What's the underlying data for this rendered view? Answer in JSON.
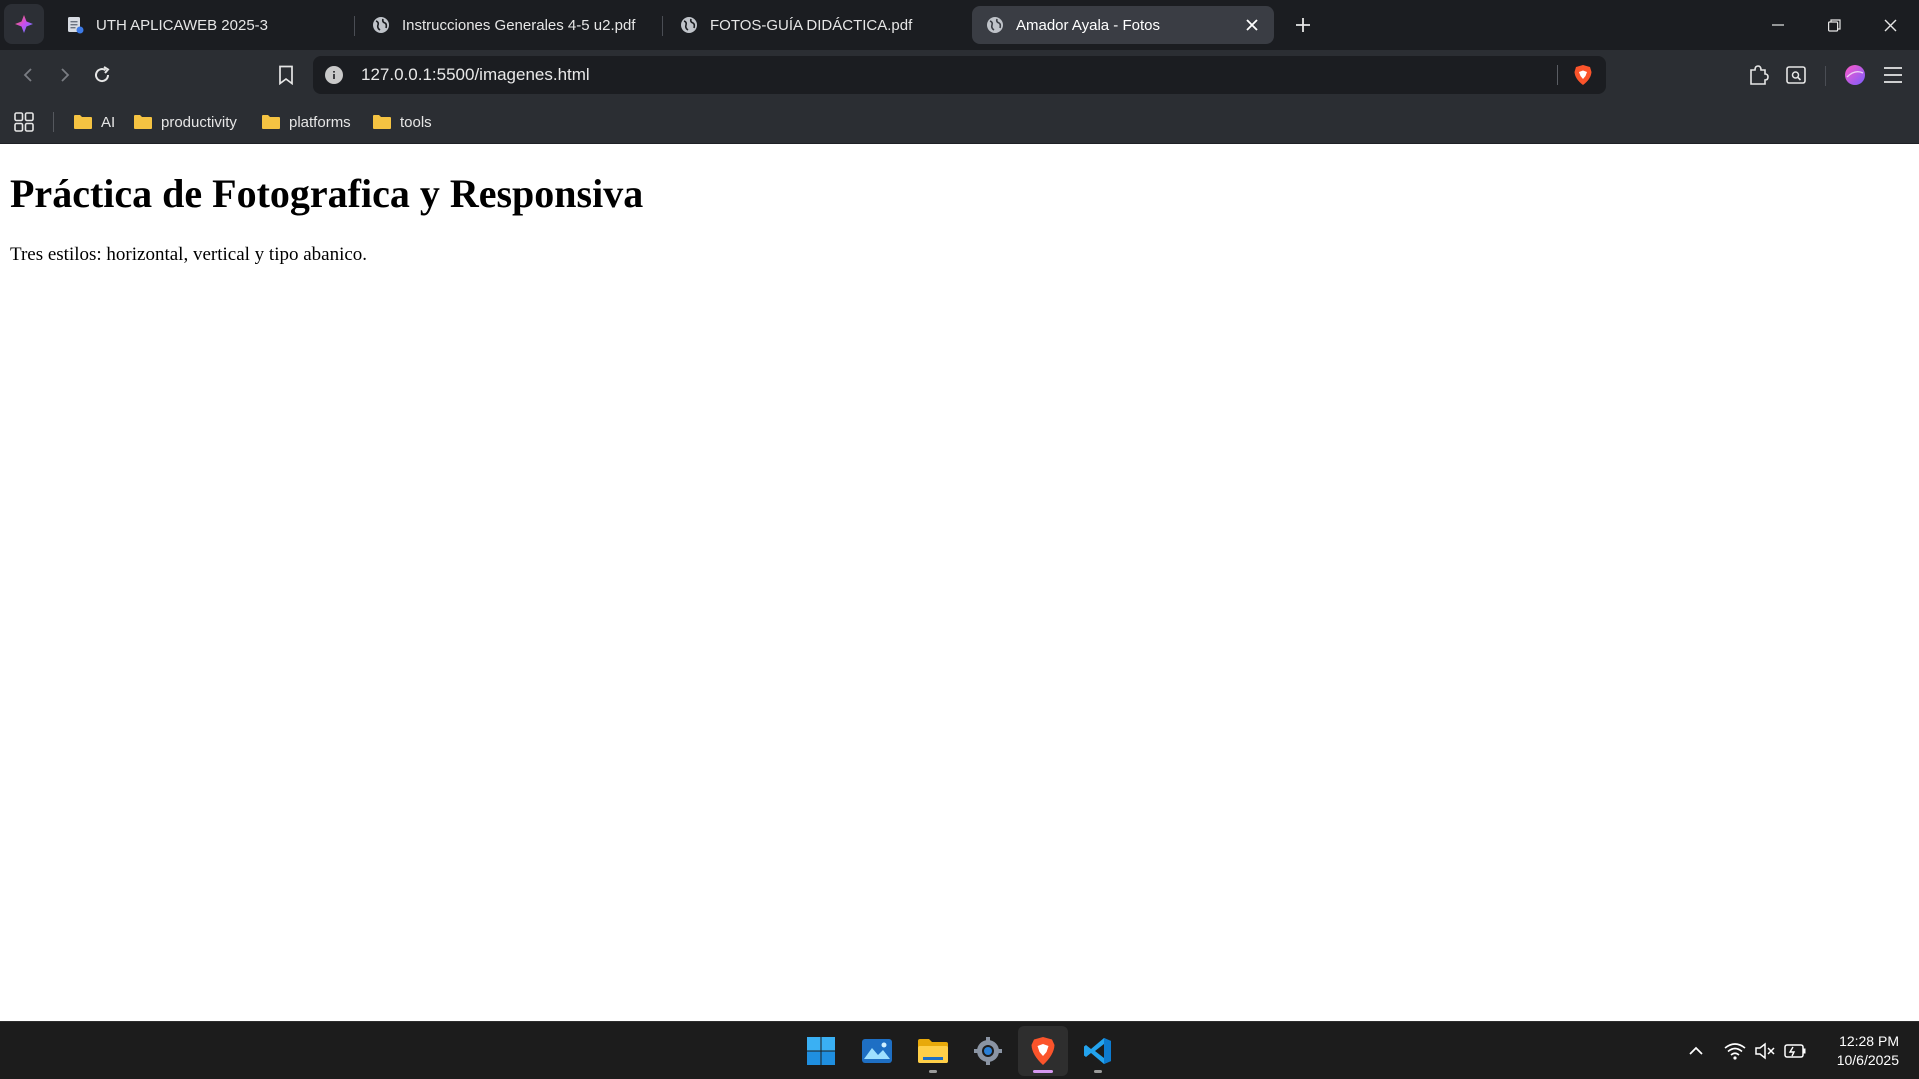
{
  "browser": {
    "tabs": [
      {
        "label": "UTH APLICAWEB 2025-3",
        "icon": "document-icon",
        "active": false
      },
      {
        "label": "Instrucciones Generales 4-5 u2.pdf",
        "icon": "globe-icon",
        "active": false
      },
      {
        "label": "FOTOS-GUÍA DIDÁCTICA.pdf",
        "icon": "globe-icon",
        "active": false
      },
      {
        "label": "Amador Ayala - Fotos",
        "icon": "globe-icon",
        "active": true
      }
    ],
    "url": "127.0.0.1:5500/imagenes.html",
    "bookmarks": [
      {
        "label": "AI"
      },
      {
        "label": "productivity"
      },
      {
        "label": "platforms"
      },
      {
        "label": "tools"
      }
    ],
    "colors": {
      "tab_bar": "#1b1d21",
      "toolbar": "#2b2e33",
      "folder": "#f5c342",
      "brave": "#fb542b"
    }
  },
  "page": {
    "heading": "Práctica de Fotografica y Responsiva",
    "description": "Tres estilos: horizontal, vertical y tipo abanico."
  },
  "taskbar": {
    "apps": [
      "windows-start-icon",
      "photos-icon",
      "file-explorer-icon",
      "settings-icon",
      "brave-browser-icon",
      "vscode-icon"
    ],
    "tray": [
      "chevron-up-icon",
      "wifi-icon",
      "volume-muted-icon",
      "battery-icon"
    ],
    "time": "12:28 PM",
    "date": "10/6/2025"
  }
}
